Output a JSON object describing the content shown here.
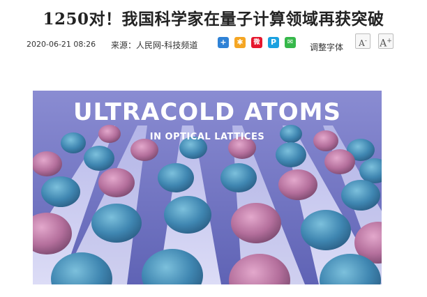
{
  "article": {
    "headline": "1250对！我国科学家在量子计算领域再获突破",
    "date": "2020-06-21 08:26",
    "source": "来源：人民网-科技频道"
  },
  "share": {
    "buttons": [
      {
        "name": "share-plus-icon",
        "glyph": "+",
        "color": "#2f82d6"
      },
      {
        "name": "qzone-icon",
        "glyph": "✱",
        "color": "#f5a623"
      },
      {
        "name": "weibo-icon",
        "glyph": "微",
        "color": "#e6162d"
      },
      {
        "name": "renren-icon",
        "glyph": "P",
        "color": "#1aa1e0"
      },
      {
        "name": "wechat-icon",
        "glyph": "✉",
        "color": "#36b84a"
      }
    ]
  },
  "font_controls": {
    "label": "调整字体",
    "decrease_label": "A",
    "decrease_suffix": "-",
    "increase_label": "A",
    "increase_suffix": "+"
  },
  "hero_image": {
    "title": "ULTRACOLD ATOMS",
    "subtitle": "IN OPTICAL LATTICES",
    "colors": {
      "background": "#7d80c7",
      "strip": "#c8c9ef",
      "atom_blue": "#3f86b1",
      "atom_pink": "#b46f9c"
    }
  }
}
